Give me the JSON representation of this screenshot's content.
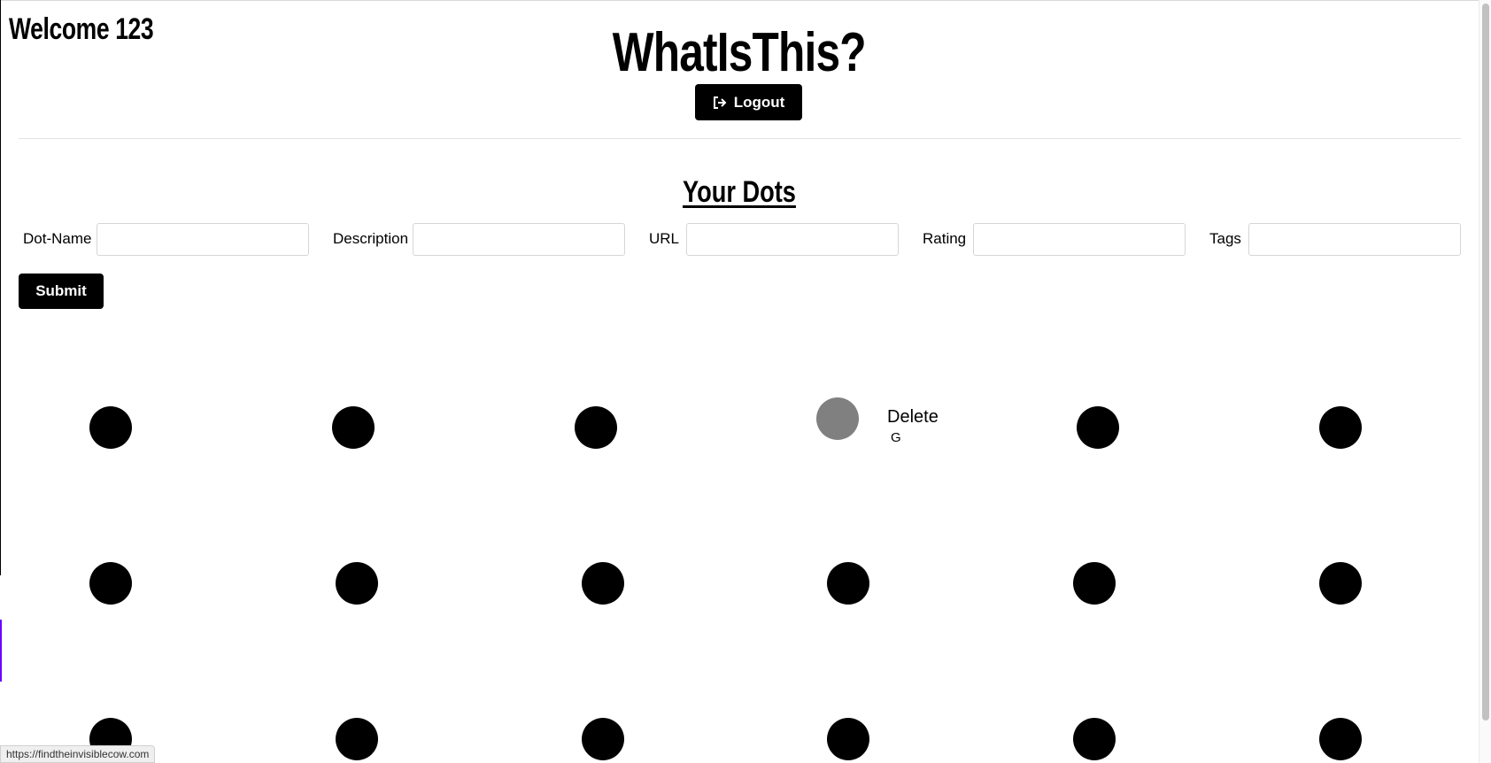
{
  "header": {
    "welcome": "Welcome 123",
    "app_title": "WhatIsThis?",
    "logout_label": "Logout"
  },
  "dots_section": {
    "title": "Your Dots"
  },
  "form": {
    "fields": [
      {
        "label": "Dot-Name",
        "value": "",
        "placeholder": ""
      },
      {
        "label": "Description",
        "value": "",
        "placeholder": ""
      },
      {
        "label": "URL",
        "value": "",
        "placeholder": ""
      },
      {
        "label": "Rating",
        "value": "",
        "placeholder": ""
      },
      {
        "label": "Tags",
        "value": "",
        "placeholder": ""
      }
    ],
    "submit_label": "Submit"
  },
  "selected_dot": {
    "action_label": "Delete",
    "name": "G"
  },
  "colors": {
    "dot": "#000000",
    "dot_selected": "#808080",
    "button_bg": "#000000",
    "button_text": "#ffffff"
  },
  "status_bar": {
    "url": "https://findtheinvisiblecow.com"
  }
}
